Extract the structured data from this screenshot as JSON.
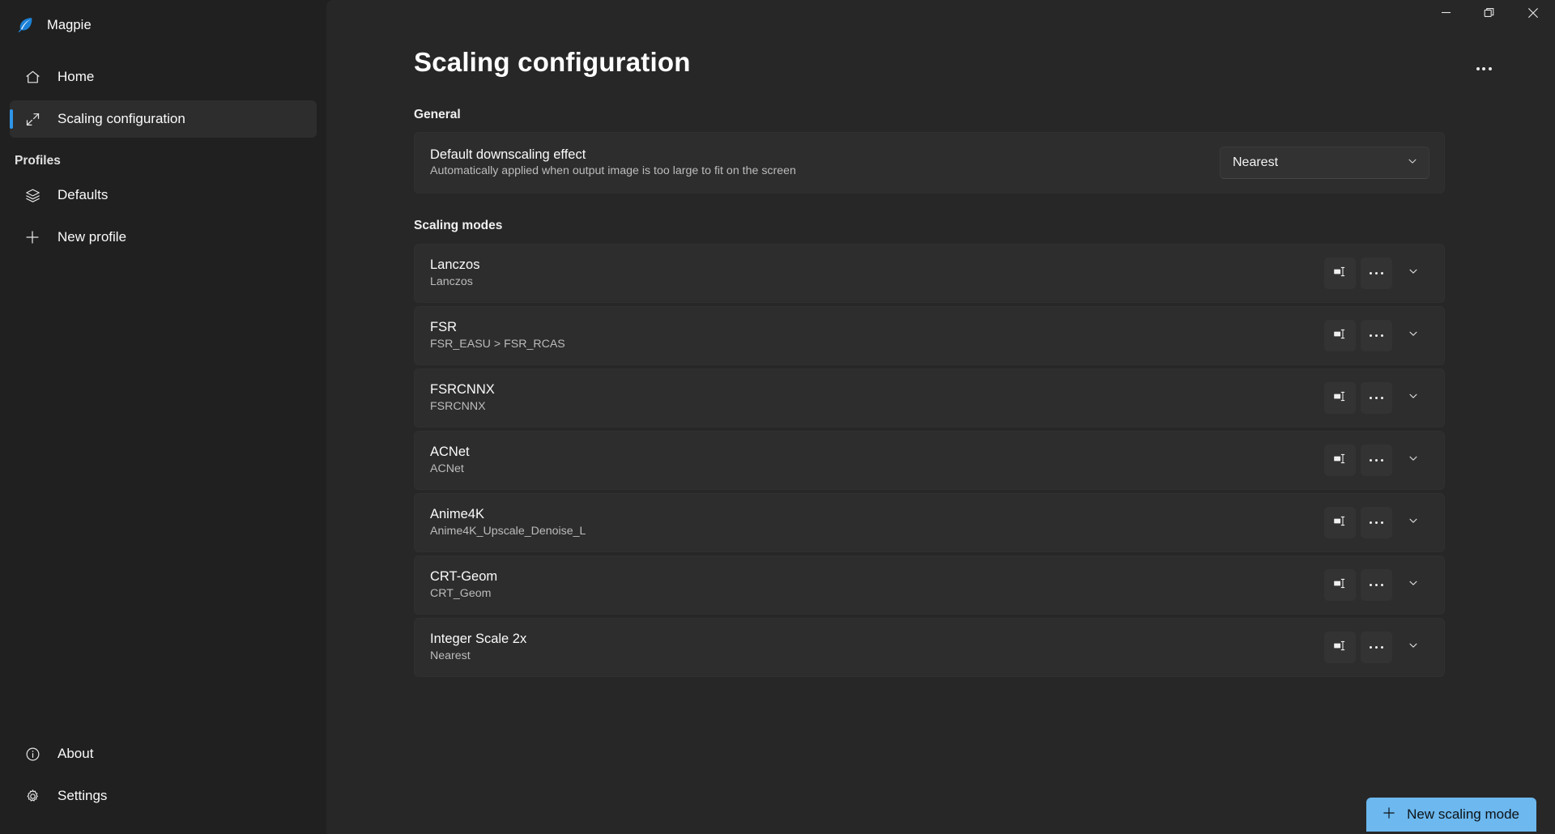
{
  "app": {
    "name": "Magpie",
    "logo_icon": "feather-icon",
    "accent_color": "#2f95e8",
    "primary_button_color": "#6cb8ef"
  },
  "window_controls": [
    {
      "name": "minimize",
      "icon": "minimize-icon",
      "label": "–"
    },
    {
      "name": "maximize",
      "icon": "restore-icon",
      "label": "❐"
    },
    {
      "name": "close",
      "icon": "close-icon",
      "label": "✕"
    }
  ],
  "sidebar": {
    "top_items": [
      {
        "label": "Home",
        "icon": "home-icon",
        "selected": false
      },
      {
        "label": "Scaling configuration",
        "icon": "resize-arrows-icon",
        "selected": true
      }
    ],
    "section_label": "Profiles",
    "profile_items": [
      {
        "label": "Defaults",
        "icon": "layers-icon",
        "selected": false
      },
      {
        "label": "New profile",
        "icon": "plus-icon",
        "selected": false
      }
    ],
    "bottom_items": [
      {
        "label": "About",
        "icon": "info-circle-icon",
        "selected": false
      },
      {
        "label": "Settings",
        "icon": "gear-icon",
        "selected": false
      }
    ]
  },
  "page": {
    "title": "Scaling configuration",
    "more_icon": "more-horizontal-icon"
  },
  "general": {
    "group_label": "General",
    "setting": {
      "title": "Default downscaling effect",
      "subtitle": "Automatically applied when output image is too large to fit on the screen",
      "dropdown": {
        "value": "Nearest",
        "chevron_icon": "chevron-down-icon"
      }
    }
  },
  "scaling_modes": {
    "group_label": "Scaling modes",
    "row_icons": {
      "rename": "rename-icon",
      "more": "more-horizontal-icon",
      "expand": "chevron-down-icon"
    },
    "items": [
      {
        "name": "Lanczos",
        "effects": "Lanczos"
      },
      {
        "name": "FSR",
        "effects": "FSR_EASU > FSR_RCAS"
      },
      {
        "name": "FSRCNNX",
        "effects": "FSRCNNX"
      },
      {
        "name": "ACNet",
        "effects": "ACNet"
      },
      {
        "name": "Anime4K",
        "effects": "Anime4K_Upscale_Denoise_L"
      },
      {
        "name": "CRT-Geom",
        "effects": "CRT_Geom"
      },
      {
        "name": "Integer Scale 2x",
        "effects": "Nearest"
      }
    ]
  },
  "new_scaling_mode_button": {
    "label": "New scaling mode",
    "icon": "plus-icon"
  }
}
